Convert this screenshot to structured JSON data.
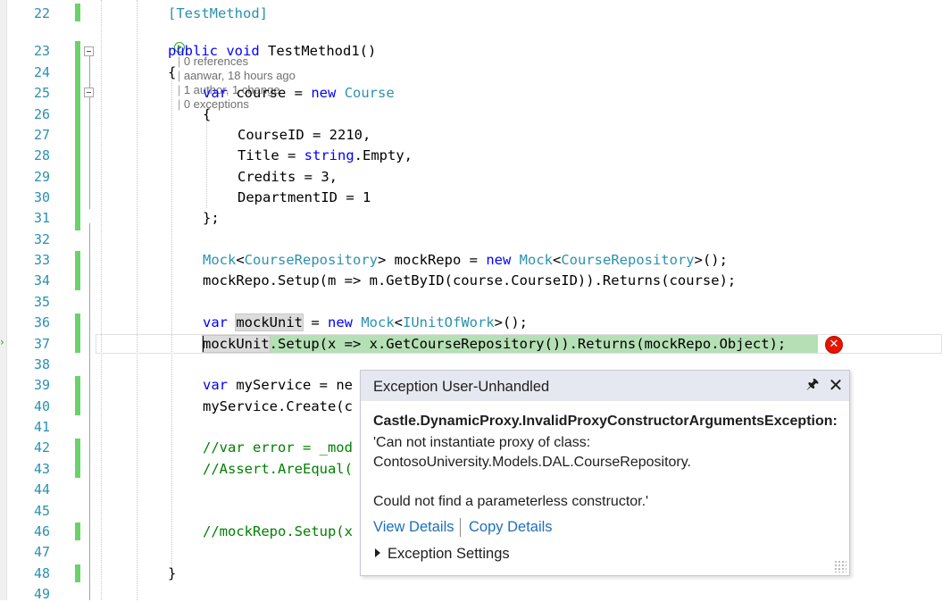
{
  "colors": {
    "keyword": "#0000ff",
    "type": "#2b91af",
    "comment": "#008000",
    "line_number": "#2b91af",
    "change_bar": "#6ad26a",
    "statement_highlight": "#b5dfb5",
    "error": "#e51400",
    "link": "#1e6fbd",
    "popup_header": "#e6e8f1"
  },
  "editor": {
    "codelens": {
      "references": "0 references",
      "author": "aanwar, 18 hours ago",
      "authors": "1 author, 1 change",
      "exceptions": "0 exceptions"
    },
    "line_numbers": [
      "22",
      "23",
      "24",
      "25",
      "26",
      "27",
      "28",
      "29",
      "30",
      "31",
      "32",
      "33",
      "34",
      "35",
      "36",
      "37",
      "38",
      "39",
      "40",
      "41",
      "42",
      "43",
      "44",
      "45",
      "46",
      "47",
      "48",
      "49"
    ],
    "lines": {
      "l22": {
        "attr": "[TestMethod]"
      },
      "l23": {
        "kw1": "public",
        "kw2": "void",
        "rest": "TestMethod1()"
      },
      "l24": {
        "text": "{"
      },
      "l25": {
        "kw1": "var",
        "mid": "course = ",
        "kw2": "new",
        "type": "Course"
      },
      "l26": {
        "text": "{"
      },
      "l27": {
        "text": "CourseID = 2210,"
      },
      "l28": {
        "pre": "Title = ",
        "kw": "string",
        "post": ".Empty,"
      },
      "l29": {
        "text": "Credits = 3,"
      },
      "l30": {
        "text": "DepartmentID = 1"
      },
      "l31": {
        "text": "};"
      },
      "l33": {
        "t1": "Mock",
        "p1": "<",
        "t2": "CourseRepository",
        "p2": "> mockRepo = ",
        "kw": "new",
        "t3": "Mock",
        "p3": "<",
        "t4": "CourseRepository",
        "p4": ">();"
      },
      "l34": {
        "text": "mockRepo.Setup(m => m.GetByID(course.CourseID)).Returns(course);"
      },
      "l36": {
        "kw1": "var",
        "ref": "mockUnit",
        "mid": " = ",
        "kw2": "new",
        "t1": "Mock",
        "p1": "<",
        "t2": "IUnitOfWork",
        "p2": ">();"
      },
      "l37": {
        "ref": "mockUnit",
        "rest": ".Setup(x => x.GetCourseRepository()).Returns(mockRepo.Object);"
      },
      "l39": {
        "kw": "var",
        "rest": "myService = ne"
      },
      "l40": {
        "text": "myService.Create(c"
      },
      "l42": {
        "text": "//var error = _mod"
      },
      "l43": {
        "text": "//Assert.AreEqual("
      },
      "l46": {
        "text": "//mockRepo.Setup(x"
      },
      "l48": {
        "text": "}"
      }
    }
  },
  "exception_popup": {
    "title": "Exception User-Unhandled",
    "pin_icon": "pin-icon",
    "close_icon": "close-icon",
    "exception_type": "Castle.DynamicProxy.InvalidProxyConstructorArgumentsException:",
    "message_line1": "'Can not instantiate proxy of class:",
    "message_line2": "ContosoUniversity.Models.DAL.CourseRepository.",
    "message_line3": "Could not find a parameterless constructor.'",
    "view_details": "View Details",
    "copy_details": "Copy Details",
    "exception_settings": "Exception Settings"
  },
  "error_glyph": "error-icon"
}
